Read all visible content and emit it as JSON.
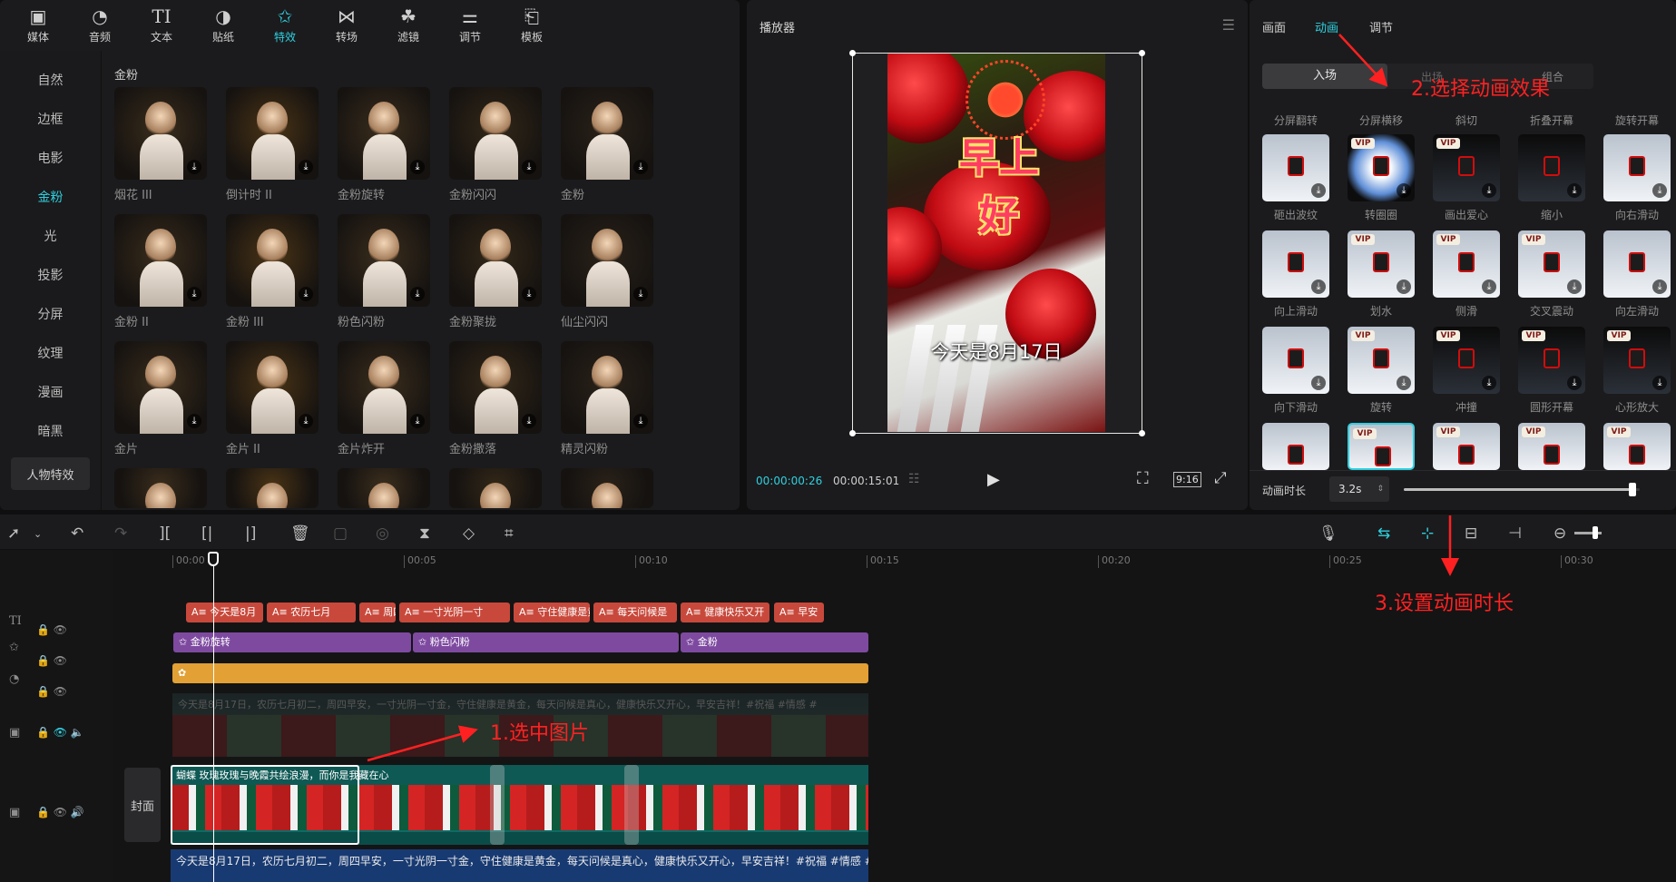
{
  "top_tabs": [
    {
      "label": "媒体",
      "icon": "media-icon"
    },
    {
      "label": "音频",
      "icon": "audio-icon"
    },
    {
      "label": "文本",
      "icon": "text-icon"
    },
    {
      "label": "贴纸",
      "icon": "sticker-icon"
    },
    {
      "label": "特效",
      "icon": "effects-icon",
      "active": true
    },
    {
      "label": "转场",
      "icon": "transition-icon"
    },
    {
      "label": "滤镜",
      "icon": "filter-icon"
    },
    {
      "label": "调节",
      "icon": "adjust-icon"
    },
    {
      "label": "模板",
      "icon": "template-icon"
    }
  ],
  "categories": [
    "自然",
    "边框",
    "电影",
    "金粉",
    "光",
    "投影",
    "分屏",
    "纹理",
    "漫画",
    "暗黑"
  ],
  "category_active": "金粉",
  "category_pill": "人物特效",
  "section_title": "金粉",
  "effects": [
    "烟花 III",
    "倒计时 II",
    "金粉旋转",
    "金粉闪闪",
    "金粉",
    "金粉 II",
    "金粉 III",
    "粉色闪粉",
    "金粉聚拢",
    "仙尘闪闪",
    "金片",
    "金片 II",
    "金片炸开",
    "金粉撒落",
    "精灵闪粉"
  ],
  "player": {
    "title": "播放器",
    "current_time": "00:00:00:26",
    "total_time": "00:00:15:01",
    "ratio": "9:16",
    "overlay_title": "早上好",
    "overlay_caption": "今天是8月17日"
  },
  "right_tabs": [
    "画面",
    "动画",
    "调节"
  ],
  "right_tab_active": "动画",
  "anim_seg": [
    "入场",
    "出场",
    "组合"
  ],
  "anim_headers": [
    "分屏翻转",
    "分屏横移",
    "斜切",
    "折叠开幕",
    "旋转开幕"
  ],
  "animations": [
    "砸出波纹",
    "转圈圈",
    "画出爱心",
    "缩小",
    "向右滑动",
    "向上滑动",
    "划水",
    "侧滑",
    "交叉震动",
    "向左滑动",
    "向下滑动",
    "旋转",
    "冲撞",
    "圆形开幕",
    "心形放大"
  ],
  "vip_label": "VIP",
  "anim_duration_label": "动画时长",
  "anim_duration_value": "3.2s",
  "annotations": {
    "step1": "1.选中图片",
    "step2": "2.选择动画效果",
    "step3": "3.设置动画时长"
  },
  "timeline": {
    "ruler": [
      "00:00",
      "00:05",
      "00:10",
      "00:15",
      "00:20",
      "00:25",
      "00:30"
    ],
    "text_clips": [
      "今天是8月",
      "农历七月",
      "周四",
      "一寸光阴一寸",
      "守住健康是黄",
      "每天问候是",
      "健康快乐又开",
      "早安"
    ],
    "effect_clips": [
      "金粉旋转",
      "粉色闪粉",
      "金粉"
    ],
    "subtitle_line": "今天是8月17日，农历七月初二，周四早安，一寸光阴一寸金，守住健康是黄金，每天问候是真心，健康快乐又开心，早安吉祥！#祝福 #情感 #",
    "cover_label": "封面",
    "main_clip_text": "蝴蝶 玫瑰玫瑰与晚霞共绘浪漫，而你是我藏在心"
  },
  "colors": {
    "accent": "#2fd0e0",
    "annotation": "#ff2121",
    "text_clip": "#c8493c",
    "effect_clip": "#7e4aa0",
    "filter_clip": "#e2a035"
  }
}
